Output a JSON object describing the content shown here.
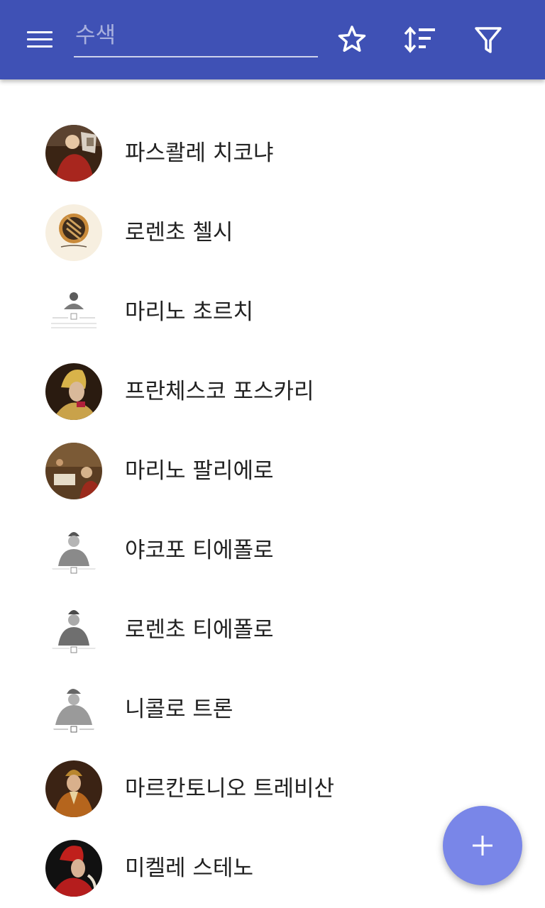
{
  "toolbar": {
    "menu_icon": "hamburger-menu-icon",
    "search_placeholder": "수색",
    "search_value": "",
    "favorites_icon": "star-outline-icon",
    "sort_icon": "sort-icon",
    "filter_icon": "filter-icon"
  },
  "list": {
    "items": [
      {
        "name": "파스콸레 치코냐"
      },
      {
        "name": "로렌초 첼시"
      },
      {
        "name": "마리노 초르치"
      },
      {
        "name": "프란체스코 포스카리"
      },
      {
        "name": "마리노 팔리에로"
      },
      {
        "name": "야코포 티에폴로"
      },
      {
        "name": "로렌초 티에폴로"
      },
      {
        "name": "니콜로 트론"
      },
      {
        "name": "마르칸토니오 트레비산"
      },
      {
        "name": "미켈레 스테노"
      }
    ]
  },
  "fab": {
    "icon": "plus-icon"
  },
  "colors": {
    "app_bar": "#3f51b5",
    "fab": "#7986e8",
    "text_primary": "#212121",
    "background": "#ffffff"
  }
}
